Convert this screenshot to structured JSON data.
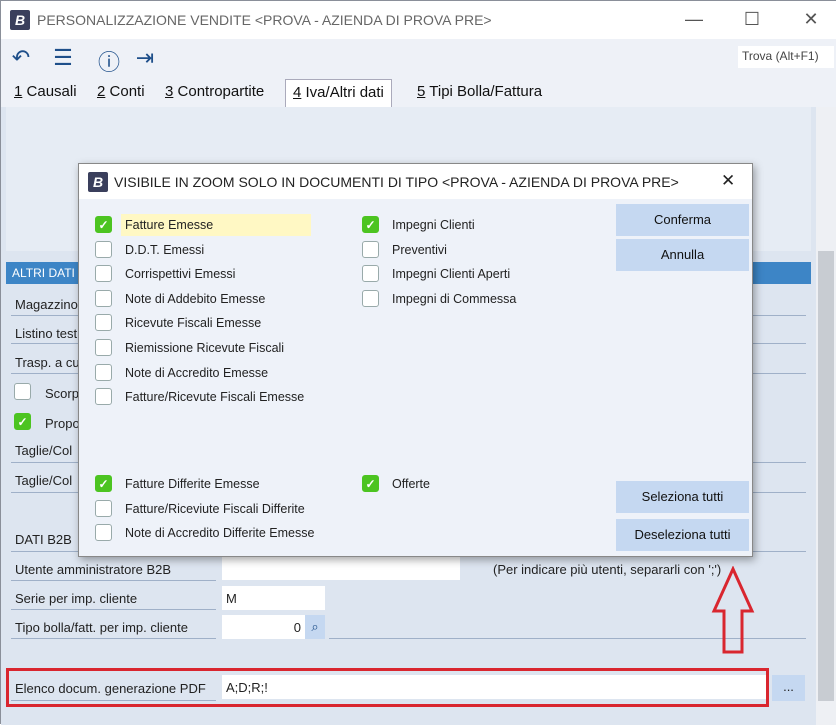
{
  "window": {
    "title": "PERSONALIZZAZIONE VENDITE <PROVA - AZIENDA DI PROVA PRE>",
    "logo": "B",
    "minimize": "—",
    "maximize": "☐",
    "close": "✕"
  },
  "toolbar": {
    "find_placeholder": "Trova (Alt+F1)"
  },
  "tabs": [
    {
      "num": "1",
      "label": "Causali"
    },
    {
      "num": "2",
      "label": "Conti"
    },
    {
      "num": "3",
      "label": "Contropartite"
    },
    {
      "num": "4",
      "label": "Iva/Altri dati"
    },
    {
      "num": "5",
      "label": "Tipi Bolla/Fattura"
    }
  ],
  "section": {
    "header": "ALTRI DATI",
    "rows": [
      "Magazzino",
      "Listino test",
      "Trasp. a cu",
      "Scorp",
      "Propo",
      "Taglie/Col",
      "Taglie/Col"
    ],
    "b2b": "DATI B2B"
  },
  "form": {
    "utente_label": "Utente amministratore B2B",
    "utente_value": "",
    "utente_hint": "(Per indicare più utenti, separarli con ';')",
    "serie_label": "Serie per imp. cliente",
    "serie_value": "M",
    "tipo_label": "Tipo bolla/fatt. per imp. cliente",
    "tipo_value": "0",
    "pdf_label": "Elenco docum. generazione PDF",
    "pdf_value": "A;D;R;!",
    "pdf_button": "..."
  },
  "dialog": {
    "title": "VISIBILE IN ZOOM SOLO IN DOCUMENTI DI TIPO <PROVA - AZIENDA DI PROVA PRE>",
    "close": "✕",
    "left": [
      {
        "label": "Fatture Emesse",
        "checked": true
      },
      {
        "label": "D.D.T. Emessi",
        "checked": false
      },
      {
        "label": "Corrispettivi Emessi",
        "checked": false
      },
      {
        "label": "Note di Addebito Emesse",
        "checked": false
      },
      {
        "label": "Ricevute Fiscali Emesse",
        "checked": false
      },
      {
        "label": "Riemissione Ricevute Fiscali",
        "checked": false
      },
      {
        "label": "Note di Accredito Emesse",
        "checked": false
      },
      {
        "label": "Fatture/Ricevute Fiscali Emesse",
        "checked": false
      }
    ],
    "right": [
      {
        "label": "Impegni Clienti",
        "checked": true
      },
      {
        "label": "Preventivi",
        "checked": false
      },
      {
        "label": "Impegni Clienti Aperti",
        "checked": false
      },
      {
        "label": "Impegni di Commessa",
        "checked": false
      }
    ],
    "left2": [
      {
        "label": "Fatture Differite Emesse",
        "checked": true
      },
      {
        "label": "Fatture/Riceviute Fiscali Differite",
        "checked": false
      },
      {
        "label": "Note di Accredito Differite Emesse",
        "checked": false
      }
    ],
    "right2": [
      {
        "label": "Offerte",
        "checked": true
      }
    ],
    "buttons": {
      "confirm": "Conferma",
      "cancel": "Annulla",
      "select_all": "Seleziona tutti",
      "deselect_all": "Deseleziona tutti"
    }
  }
}
